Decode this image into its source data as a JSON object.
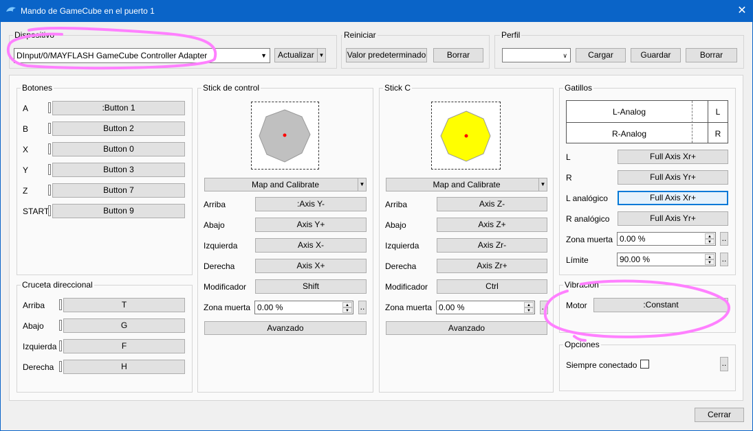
{
  "window": {
    "title": "Mando de GameCube en el puerto 1",
    "close": "✕"
  },
  "device": {
    "group_title": "Dispositivo",
    "selected": "DInput/0/MAYFLASH GameCube Controller Adapter",
    "refresh": "Actualizar"
  },
  "reset": {
    "group_title": "Reiniciar",
    "default": "Valor predeterminado",
    "clear": "Borrar"
  },
  "profile": {
    "group_title": "Perfil",
    "selected": "",
    "load": "Cargar",
    "save": "Guardar",
    "delete": "Borrar"
  },
  "buttons": {
    "group_title": "Botones",
    "items": [
      {
        "label": "A",
        "binding": ":Button 1"
      },
      {
        "label": "B",
        "binding": "Button 2"
      },
      {
        "label": "X",
        "binding": "Button 0"
      },
      {
        "label": "Y",
        "binding": "Button 3"
      },
      {
        "label": "Z",
        "binding": "Button 7"
      },
      {
        "label": "START",
        "binding": "Button 9"
      }
    ]
  },
  "dpad": {
    "group_title": "Cruceta direccional",
    "items": [
      {
        "label": "Arriba",
        "binding": "T"
      },
      {
        "label": "Abajo",
        "binding": "G"
      },
      {
        "label": "Izquierda",
        "binding": "F"
      },
      {
        "label": "Derecha",
        "binding": "H"
      }
    ]
  },
  "main_stick": {
    "group_title": "Stick de control",
    "calibrate": "Map and Calibrate",
    "items": [
      {
        "label": "Arriba",
        "binding": ":Axis Y-"
      },
      {
        "label": "Abajo",
        "binding": "Axis Y+"
      },
      {
        "label": "Izquierda",
        "binding": "Axis X-"
      },
      {
        "label": "Derecha",
        "binding": "Axis X+"
      },
      {
        "label": "Modificador",
        "binding": "Shift"
      }
    ],
    "deadzone_label": "Zona muerta",
    "deadzone_value": "0.00 %",
    "advanced": "Avanzado",
    "gate_color": "#c0c0c0"
  },
  "c_stick": {
    "group_title": "Stick C",
    "calibrate": "Map and Calibrate",
    "items": [
      {
        "label": "Arriba",
        "binding": "Axis Z-"
      },
      {
        "label": "Abajo",
        "binding": "Axis Z+"
      },
      {
        "label": "Izquierda",
        "binding": "Axis Zr-"
      },
      {
        "label": "Derecha",
        "binding": "Axis Zr+"
      },
      {
        "label": "Modificador",
        "binding": "Ctrl"
      }
    ],
    "deadzone_label": "Zona muerta",
    "deadzone_value": "0.00 %",
    "advanced": "Avanzado",
    "gate_color": "#ffff00"
  },
  "triggers": {
    "group_title": "Gatillos",
    "analog_rows": [
      {
        "name": "L-Analog",
        "key": "L"
      },
      {
        "name": "R-Analog",
        "key": "R"
      }
    ],
    "items": [
      {
        "label": "L",
        "binding": "Full Axis Xr+"
      },
      {
        "label": "R",
        "binding": "Full Axis Yr+"
      },
      {
        "label": "L analógico",
        "binding": "Full Axis Xr+"
      },
      {
        "label": "R analógico",
        "binding": "Full Axis Yr+"
      }
    ],
    "deadzone_label": "Zona muerta",
    "deadzone_value": "0.00 %",
    "limit_label": "Límite",
    "limit_value": "90.00 %"
  },
  "rumble": {
    "group_title": "Vibración",
    "motor_label": "Motor",
    "motor_binding": ":Constant"
  },
  "options": {
    "group_title": "Opciones",
    "always_connected": "Siempre conectado"
  },
  "footer": {
    "close": "Cerrar"
  },
  "ellipsis": "..",
  "colors": {
    "accent": "#0a64c8",
    "focus": "#0078d7",
    "highlight": "#ff80ff",
    "indicator": "#ff0000"
  }
}
